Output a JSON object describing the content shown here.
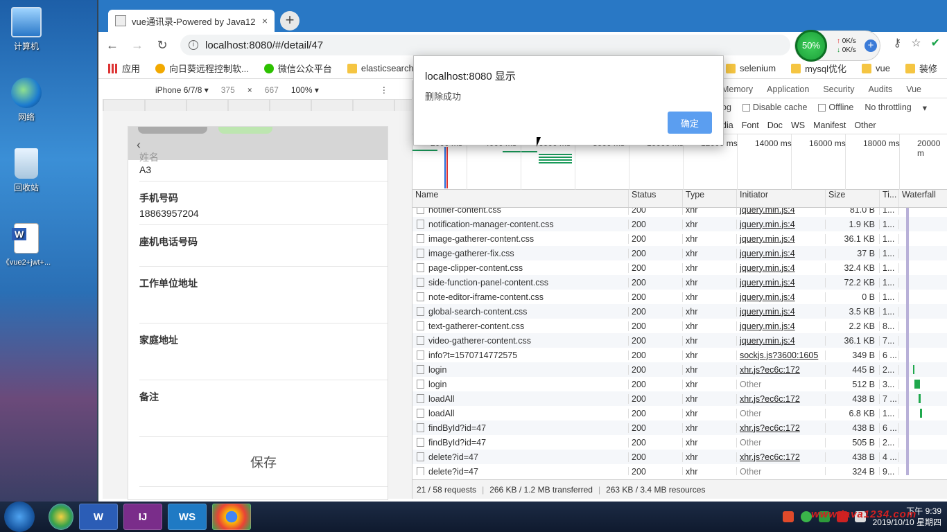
{
  "desktop": {
    "icons": [
      {
        "label": "计算机"
      },
      {
        "label": "网络"
      },
      {
        "label": "回收站"
      },
      {
        "label": "《vue2+jwt+..."
      }
    ]
  },
  "browser": {
    "tab_title": "vue通讯录-Powered by Java12",
    "tab_close": "×",
    "new_tab": "+",
    "url": "localhost:8080/#/detail/47",
    "net_widget": {
      "percent": "50%",
      "up": "0K/s",
      "down": "0K/s"
    },
    "bookmarks": [
      {
        "label": "应用",
        "icon": "apps-icon"
      },
      {
        "label": "向日葵远程控制软...",
        "icon": "sunflower-icon"
      },
      {
        "label": "微信公众平台",
        "icon": "wechat-icon"
      },
      {
        "label": "elasticsearch",
        "icon": "folder-icon"
      },
      {
        "label": "selenium",
        "icon": "folder-icon"
      },
      {
        "label": "mysql优化",
        "icon": "folder-icon"
      },
      {
        "label": "vue",
        "icon": "folder-icon"
      },
      {
        "label": "装修",
        "icon": "folder-icon"
      }
    ]
  },
  "device_toolbar": {
    "device": "iPhone 6/7/8 ▾",
    "width": "375",
    "times": "×",
    "height": "667",
    "zoom": "100% ▾",
    "more": "⋮"
  },
  "phone_page": {
    "name_label": "姓名",
    "name_value": "A3",
    "mobile_label": "手机号码",
    "mobile_value": "18863957204",
    "landline_label": "座机电话号码",
    "work_address_label": "工作单位地址",
    "home_address_label": "家庭地址",
    "notes_label": "备注",
    "save_button": "保存"
  },
  "devtools": {
    "tabs": [
      "Memory",
      "Application",
      "Security",
      "Audits",
      "Vue"
    ],
    "options": {
      "log": "og",
      "disable_cache": "Disable cache",
      "offline": "Offline",
      "throttling": "No throttling",
      "dropdown": "▾"
    },
    "filters": [
      "dia",
      "Font",
      "Doc",
      "WS",
      "Manifest",
      "Other"
    ],
    "timeline_ticks": [
      "2000 ms",
      "4000 ms",
      "6000 ms",
      "8000 ms",
      "10000 ms",
      "12000 ms",
      "14000 ms",
      "16000 ms",
      "18000 ms",
      "20000 m"
    ],
    "columns": {
      "name": "Name",
      "status": "Status",
      "type": "Type",
      "initiator": "Initiator",
      "size": "Size",
      "time": "Ti...",
      "waterfall": "Waterfall"
    },
    "rows": [
      {
        "name": "notifier-content.css",
        "status": "200",
        "type": "xhr",
        "initiator": "jquery.min.js:4",
        "size": "81.0 B",
        "time": "1...",
        "kind": "link"
      },
      {
        "name": "notification-manager-content.css",
        "status": "200",
        "type": "xhr",
        "initiator": "jquery.min.js:4",
        "size": "1.9 KB",
        "time": "1...",
        "kind": "link"
      },
      {
        "name": "image-gatherer-content.css",
        "status": "200",
        "type": "xhr",
        "initiator": "jquery.min.js:4",
        "size": "36.1 KB",
        "time": "1...",
        "kind": "link"
      },
      {
        "name": "image-gatherer-fix.css",
        "status": "200",
        "type": "xhr",
        "initiator": "jquery.min.js:4",
        "size": "37 B",
        "time": "1...",
        "kind": "link"
      },
      {
        "name": "page-clipper-content.css",
        "status": "200",
        "type": "xhr",
        "initiator": "jquery.min.js:4",
        "size": "32.4 KB",
        "time": "1...",
        "kind": "link"
      },
      {
        "name": "side-function-panel-content.css",
        "status": "200",
        "type": "xhr",
        "initiator": "jquery.min.js:4",
        "size": "72.2 KB",
        "time": "1...",
        "kind": "link"
      },
      {
        "name": "note-editor-iframe-content.css",
        "status": "200",
        "type": "xhr",
        "initiator": "jquery.min.js:4",
        "size": "0 B",
        "time": "1...",
        "kind": "link"
      },
      {
        "name": "global-search-content.css",
        "status": "200",
        "type": "xhr",
        "initiator": "jquery.min.js:4",
        "size": "3.5 KB",
        "time": "1...",
        "kind": "link"
      },
      {
        "name": "text-gatherer-content.css",
        "status": "200",
        "type": "xhr",
        "initiator": "jquery.min.js:4",
        "size": "2.2 KB",
        "time": "8...",
        "kind": "link"
      },
      {
        "name": "video-gatherer-content.css",
        "status": "200",
        "type": "xhr",
        "initiator": "jquery.min.js:4",
        "size": "36.1 KB",
        "time": "7...",
        "kind": "link"
      },
      {
        "name": "info?t=1570714772575",
        "status": "200",
        "type": "xhr",
        "initiator": "sockjs.js?3600:1605",
        "size": "349 B",
        "time": "6 ...",
        "kind": "link"
      },
      {
        "name": "login",
        "status": "200",
        "type": "xhr",
        "initiator": "xhr.js?ec6c:172",
        "size": "445 B",
        "time": "2...",
        "kind": "link"
      },
      {
        "name": "login",
        "status": "200",
        "type": "xhr",
        "initiator": "Other",
        "size": "512 B",
        "time": "3...",
        "kind": "other"
      },
      {
        "name": "loadAll",
        "status": "200",
        "type": "xhr",
        "initiator": "xhr.js?ec6c:172",
        "size": "438 B",
        "time": "7 ...",
        "kind": "link"
      },
      {
        "name": "loadAll",
        "status": "200",
        "type": "xhr",
        "initiator": "Other",
        "size": "6.8 KB",
        "time": "1...",
        "kind": "other"
      },
      {
        "name": "findById?id=47",
        "status": "200",
        "type": "xhr",
        "initiator": "xhr.js?ec6c:172",
        "size": "438 B",
        "time": "6 ...",
        "kind": "link"
      },
      {
        "name": "findById?id=47",
        "status": "200",
        "type": "xhr",
        "initiator": "Other",
        "size": "505 B",
        "time": "2...",
        "kind": "other"
      },
      {
        "name": "delete?id=47",
        "status": "200",
        "type": "xhr",
        "initiator": "xhr.js?ec6c:172",
        "size": "438 B",
        "time": "4 ...",
        "kind": "link"
      },
      {
        "name": "delete?id=47",
        "status": "200",
        "type": "xhr",
        "initiator": "Other",
        "size": "324 B",
        "time": "9...",
        "kind": "other"
      }
    ],
    "status": {
      "requests": "21 / 58 requests",
      "transferred": "266 KB / 1.2 MB transferred",
      "resources": "263 KB / 3.4 MB resources"
    }
  },
  "alert": {
    "title": "localhost:8080 显示",
    "message": "删除成功",
    "ok_button": "确定"
  },
  "taskbar": {
    "apps": [
      "W",
      "IJ",
      "WS"
    ],
    "clock_time": "下午 9:39",
    "clock_date": "2019/10/10 星期四",
    "watermark": "www.java1234.com"
  }
}
